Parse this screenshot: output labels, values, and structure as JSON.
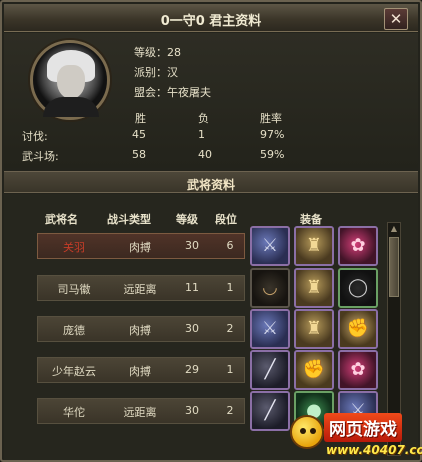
{
  "window": {
    "title": "0一守0  君主资料",
    "close_label": "✕"
  },
  "lord": {
    "level_label": "等级：28",
    "faction_label": "派别：汉",
    "alliance_label": "盟会：午夜屠夫"
  },
  "stats": {
    "headers": [
      "胜",
      "负",
      "胜率"
    ],
    "rows": [
      {
        "label": "讨伐:",
        "win": "45",
        "loss": "1",
        "rate": "97%"
      },
      {
        "label": "武斗场:",
        "win": "58",
        "loss": "40",
        "rate": "59%"
      }
    ]
  },
  "generals": {
    "section_title": "武将资料",
    "columns": [
      "武将名",
      "战斗类型",
      "等级",
      "段位",
      "装备"
    ],
    "rows": [
      {
        "name": "关羽",
        "type": "肉搏",
        "level": "30",
        "rank": "6",
        "selected": true,
        "equipment": [
          "blade-icon",
          "armor-icon",
          "rose-icon"
        ]
      },
      {
        "name": "司马徽",
        "type": "远距离",
        "level": "11",
        "rank": "1",
        "selected": false,
        "equipment": [
          "necklace-icon",
          "armor-icon",
          "ring-icon"
        ]
      },
      {
        "name": "庞德",
        "type": "肉搏",
        "level": "30",
        "rank": "2",
        "selected": false,
        "equipment": [
          "blade-icon",
          "armor-icon",
          "gauntlet-icon"
        ]
      },
      {
        "name": "少年赵云",
        "type": "肉搏",
        "level": "29",
        "rank": "1",
        "selected": false,
        "equipment": [
          "spear-icon",
          "gauntlet-icon",
          "rose-icon"
        ]
      },
      {
        "name": "华佗",
        "type": "远距离",
        "level": "30",
        "rank": "2",
        "selected": false,
        "equipment": [
          "spear-icon",
          "orb-icon",
          "blade-icon"
        ]
      }
    ]
  },
  "watermark": {
    "line1": "网页游戏",
    "line2": "www.40407.com"
  }
}
